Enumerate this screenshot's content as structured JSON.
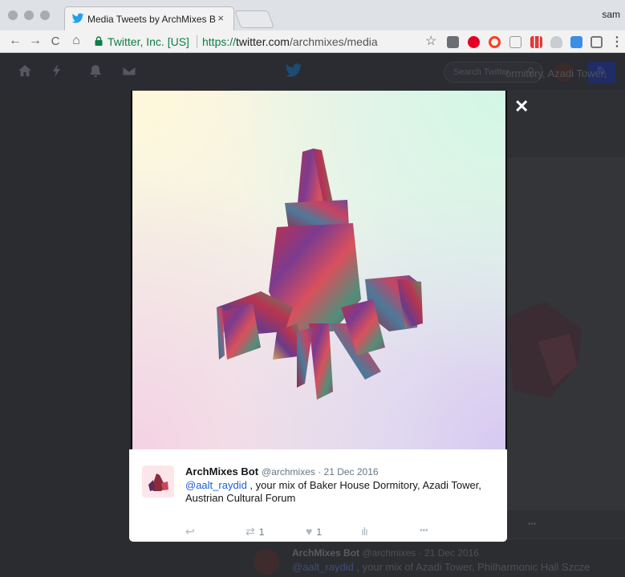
{
  "browser": {
    "tab_title": "Media Tweets by ArchMixes Bc",
    "tab_close": "×",
    "profile_name": "sam",
    "nav": {
      "back": "←",
      "forward": "→",
      "reload": "C",
      "home": "⌂"
    },
    "security_label": "Twitter, Inc. [US]",
    "url_scheme": "https://",
    "url_host": "twitter.com",
    "url_path": "/archmixes/media",
    "bookmark_star": "☆",
    "menu": "⋮"
  },
  "twitter_nav": {
    "search_placeholder": "Search Twitter",
    "search_icon": "⚲",
    "compose_icon": "✎"
  },
  "background": {
    "top_text": "ormitory, Azadi Tower,",
    "tweet": {
      "name": "ArchMixes Bot",
      "meta": "@archmixes · 21 Dec 2016",
      "mention": "@aalt_raydid",
      "text": " , your mix of Azadi Tower, Philharmonic Hall Szcze"
    },
    "more_icon": "•••"
  },
  "lightbox": {
    "close": "✕",
    "tweet": {
      "name": "ArchMixes Bot",
      "meta": "@archmixes · 21 Dec 2016",
      "mention": "@aalt_raydid",
      "text": " , your mix of Baker House Dormitory, Azadi Tower, Austrian Cultural Forum",
      "actions": {
        "reply_icon": "↩",
        "retweet_icon": "⇄",
        "retweet_count": "1",
        "like_icon": "♥",
        "like_count": "1",
        "analytics_icon": "ılı",
        "more_icon": "•••"
      }
    }
  },
  "colors": {
    "twitter_blue": "#1da1f2",
    "mention": "#1b5fd6",
    "secure_green": "#0b8043"
  }
}
